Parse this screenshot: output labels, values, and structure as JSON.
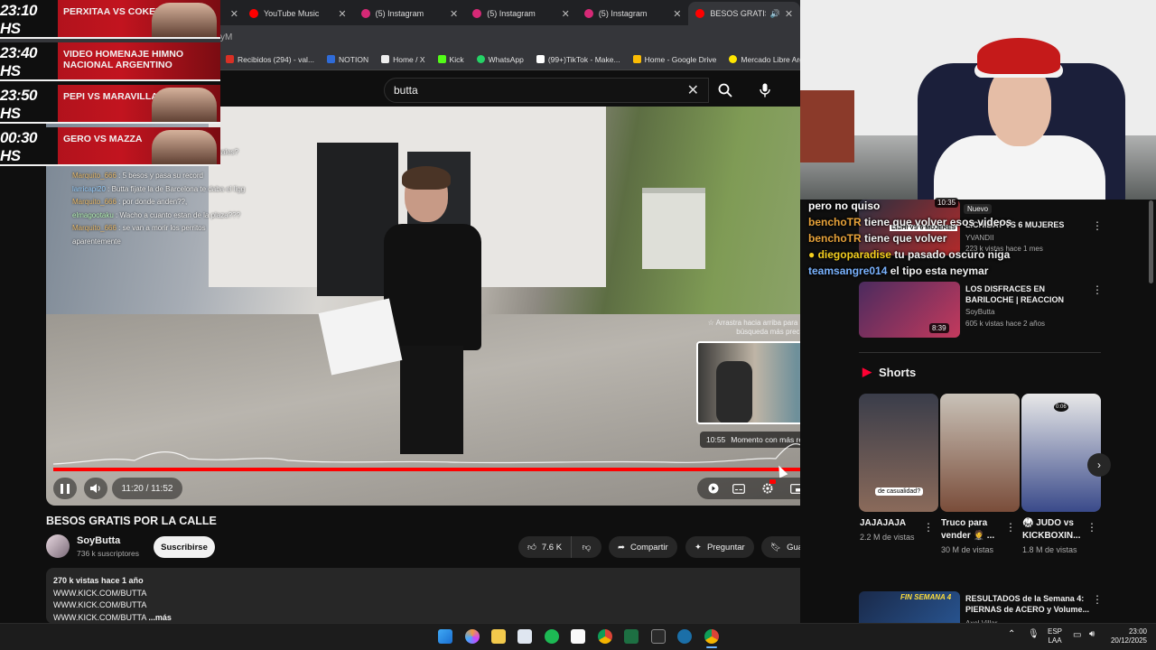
{
  "tabs": [
    {
      "label": "",
      "active": false
    },
    {
      "label": "YouTube Music",
      "active": false,
      "color": "#ff0000"
    },
    {
      "label": "(5) Instagram",
      "active": false,
      "color": "#d62976"
    },
    {
      "label": "(5) Instagram",
      "active": false,
      "color": "#d62976"
    },
    {
      "label": "(5) Instagram",
      "active": false,
      "color": "#d62976"
    },
    {
      "label": "BESOS GRATIS P",
      "active": true,
      "color": "#ff0000"
    }
  ],
  "address_fragment": "yM",
  "bookmarks": [
    {
      "label": "Recibidos (294) - val...",
      "color": "#d93025"
    },
    {
      "label": "NOTION",
      "color": "#2f6bd8"
    },
    {
      "label": "Home / X",
      "color": "#eeeeee"
    },
    {
      "label": "Kick",
      "color": "#53fc18"
    },
    {
      "label": "WhatsApp",
      "color": "#25d366"
    },
    {
      "label": "(99+)TikTok - Make...",
      "color": "#ffffff"
    },
    {
      "label": "Home - Google Drive",
      "color": "#fbbc04"
    },
    {
      "label": "Mercado Libre Arge...",
      "color": "#ffe600"
    }
  ],
  "search": {
    "value": "butta"
  },
  "schedule": [
    {
      "time": "23:10 HS",
      "name": "PERXITAA VS COKER"
    },
    {
      "time": "23:40 HS",
      "name": "VIDEO HOMENAJE HIMNO NACIONAL ARGENTINO"
    },
    {
      "time": "23:50 HS",
      "name": "PEPI VS MARAVILLA"
    },
    {
      "time": "00:30 HS",
      "name": "GERO VS MAZZA"
    }
  ],
  "chat_overlay": {
    "partial1": "ga",
    "partial2": "nimales?",
    "lines": [
      {
        "user": "Marquito_666",
        "msg": ": 5 besos y pasa su record"
      },
      {
        "user": "larricapi20",
        "msg": ": Butta fijate la de Barcelona te daba el ligg"
      },
      {
        "user": "Marquito_666",
        "msg": ": por donde anden??,"
      },
      {
        "user": "elmagootaku",
        "msg": ": Wacho a cuanto estan de la plaza???"
      },
      {
        "user": "Marquito_666",
        "msg": ": se van a morir los perritos aparentemente"
      }
    ]
  },
  "player": {
    "preview_tip": "Arrastra hacia arriba para realizar una búsqueda más precisa",
    "chapter_time": "10:55",
    "chapter_label": "Momento con más reprodu...",
    "time": "11:20 / 11:52",
    "progress": 0.962
  },
  "video": {
    "title": "BESOS GRATIS POR LA CALLE",
    "channel": "SoyButta",
    "subscribers": "736 k suscriptores",
    "subscribe": "Suscribirse",
    "likes": "7.6 K",
    "share": "Compartir",
    "ask": "Preguntar",
    "save": "Guardar",
    "desc_meta": "270 k vistas  hace 1 año",
    "desc_lines": [
      "WWW.KICK.COM/BUTTA",
      "WWW.KICK.COM/BUTTA",
      "WWW.KICK.COM/BUTTA"
    ],
    "more": "...más"
  },
  "right_chat": [
    {
      "user": "pero no quiso",
      "msg": "",
      "color": "#ffffff"
    },
    {
      "user": "benchoTR",
      "msg": "tiene que volver esos videos",
      "color": "#e8a33a"
    },
    {
      "user": "benchoTR",
      "msg": "tiene que volver",
      "color": "#e8a33a"
    },
    {
      "user": "diegoparadise",
      "msg": "tu pasado oscuro niga",
      "color": "#f5d020"
    },
    {
      "user": "teamsangre014",
      "msg": "el tipo esta neymar",
      "color": "#7ab3ff"
    }
  ],
  "related": [
    {
      "title": "LICHIBAT VS 6 MUJERES",
      "meta1": "YVANDII",
      "meta2": "223 k vistas  hace 1 mes",
      "duration": "10:35",
      "badge": "Nuevo",
      "thumb_text": "LICHI VS 6 MUJERES"
    },
    {
      "title": "LOS DISFRACES EN BARILOCHE | REACCION",
      "meta1": "SoyButta",
      "meta2": "605 k vistas  hace 2 años",
      "duration": "8:39"
    },
    {
      "title": "RESULTADOS de la Semana 4: PIERNAS de ACERO y Volume...",
      "meta1": "Axel Villar",
      "meta2": "",
      "duration": "",
      "thumb_text": "FIN SEMANA 4"
    }
  ],
  "shorts": {
    "heading": "Shorts",
    "items": [
      {
        "title": "JAJAJAJA",
        "views": "2.2 M de vistas",
        "caption": "de casualidad?"
      },
      {
        "title": "Truco para vender 🤵 ...",
        "views": "30 M de vistas"
      },
      {
        "title": "🥋 JUDO vs KICKBOXIN...",
        "views": "1.8 M de vistas",
        "caption": "0:06"
      }
    ]
  },
  "tray": {
    "lang1": "ESP",
    "lang2": "LAA",
    "time": "23:00",
    "date": "20/12/2025"
  },
  "taskbar_icons": [
    "windows-start",
    "copilot",
    "file-explorer",
    "store",
    "spotify",
    "app-s",
    "chrome",
    "excel",
    "epic-games",
    "steam",
    "chrome-active"
  ]
}
